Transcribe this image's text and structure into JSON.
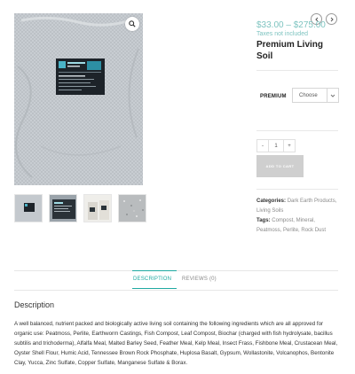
{
  "product": {
    "price_range": "$33.00 – $275.00",
    "tax_note": "Taxes not included",
    "title": "Premium Living Soil",
    "thumbnail_count": 4
  },
  "variant": {
    "label": "PREMIUM",
    "select_placeholder": "Choose"
  },
  "quantity": {
    "minus": "-",
    "value": "1",
    "plus": "+"
  },
  "add_to_cart": "ADD TO CART",
  "meta": {
    "categories_label": "Categories:",
    "categories": [
      "Dark Earth Products",
      "Living Soils"
    ],
    "tags_label": "Tags:",
    "tags": [
      "Compost",
      "Mineral",
      "Peatmoss",
      "Perlite",
      "Rock Dust"
    ]
  },
  "tabs": {
    "description": "DESCRIPTION",
    "reviews": "REVIEWS (0)"
  },
  "description": {
    "heading": "Description",
    "text": "A well balanced, nutrient packed and biologically active living soil containing the following ingredients which are all approved for organic use: Peatmoss, Perlite, Earthworm Castings, Fish Compost, Leaf Compost, Biochar (charged with fish hydrolysate, bacillus subtilis and trichoderma), Alfalfa Meal, Malted Barley Seed, Feather Meal, Kelp Meal, Insect Frass, Fishbone Meal, Crustacean Meal, Oyster Shell Flour, Humic Acid, Tennessee Brown Rock Phosphate, Huplosa Basalt, Gypsum, Wollastonite, Volcanophos, Bentonite Clay, Yucca, Zinc Sulfate, Copper Sulfate, Manganese Sulfate & Borax."
  },
  "icons": {
    "zoom": "search-icon",
    "prev": "chevron-left-icon",
    "next": "chevron-right-icon",
    "select_chevron": "chevron-down-icon"
  },
  "colors": {
    "accent": "#1fa9a1",
    "price": "#7ec4c0",
    "button_disabled": "#cfcfcf"
  }
}
